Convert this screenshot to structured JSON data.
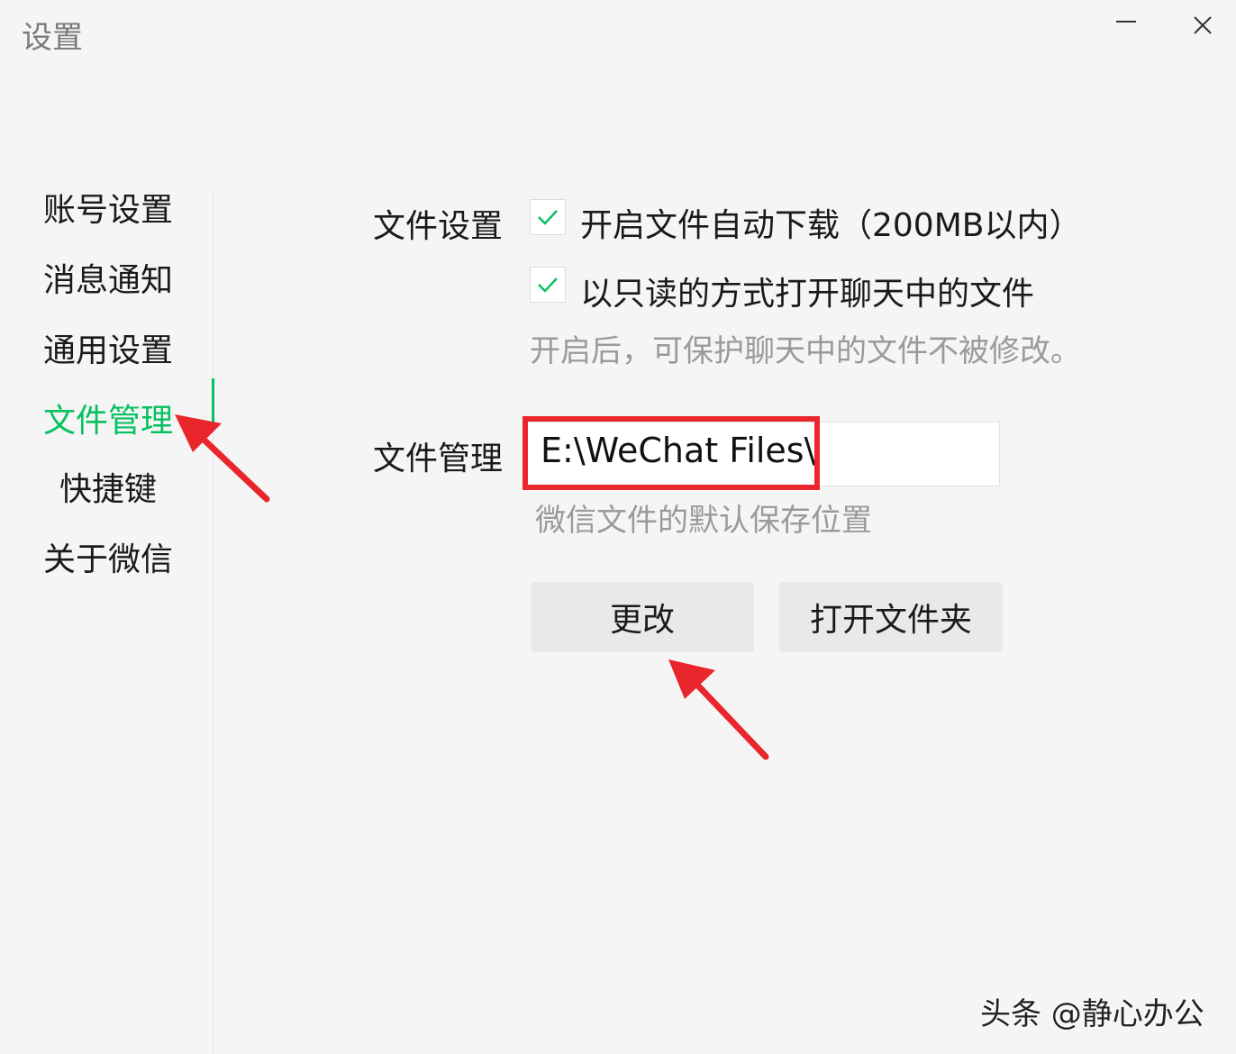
{
  "window": {
    "title": "设置"
  },
  "sidebar": {
    "items": [
      {
        "label": "账号设置"
      },
      {
        "label": "消息通知"
      },
      {
        "label": "通用设置"
      },
      {
        "label": "文件管理",
        "active": true
      },
      {
        "label": "快捷键"
      },
      {
        "label": "关于微信"
      }
    ]
  },
  "file_settings": {
    "label": "文件设置",
    "options": [
      {
        "label": "开启文件自动下载（200MB以内）",
        "checked": true
      },
      {
        "label": "以只读的方式打开聊天中的文件",
        "checked": true
      }
    ],
    "hint": "开启后，可保护聊天中的文件不被修改。"
  },
  "file_management": {
    "label": "文件管理",
    "path": "E:\\WeChat Files\\",
    "hint": "微信文件的默认保存位置",
    "change_button": "更改",
    "open_folder_button": "打开文件夹"
  },
  "watermark": "头条 @静心办公",
  "colors": {
    "accent": "#07c160",
    "highlight": "#e8262c",
    "background": "#f5f5f5"
  }
}
